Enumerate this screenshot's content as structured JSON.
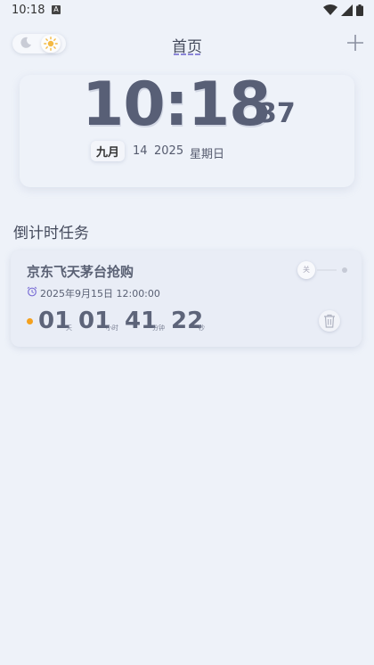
{
  "status_bar": {
    "time": "10:18",
    "notif_letter": "A"
  },
  "header": {
    "title": "首页"
  },
  "clock": {
    "hours_minutes": "10:18",
    "seconds": "37",
    "month": "九月",
    "day": "14",
    "year": "2025",
    "weekday": "星期日"
  },
  "tasks_section": {
    "title": "倒计时任务",
    "tasks": [
      {
        "title": "京东飞天茅台抢购",
        "datetime": "2025年9月15日 12:00:00",
        "toggle_label": "关",
        "countdown": {
          "days": "01",
          "days_unit": "天",
          "hours": "01",
          "hours_unit": "小时",
          "minutes": "41",
          "minutes_unit": "分钟",
          "seconds": "22",
          "seconds_unit": "秒"
        }
      }
    ]
  },
  "colors": {
    "background": "#eef2f9",
    "accent_underline": "#8b86d8",
    "countdown_dot": "#f4a11f",
    "primary_text": "#585f76"
  },
  "icons": {
    "theme_dark": "moon-icon",
    "theme_light": "sun-icon",
    "add": "plus-icon",
    "alarm": "alarm-clock-icon",
    "delete": "trash-icon"
  }
}
